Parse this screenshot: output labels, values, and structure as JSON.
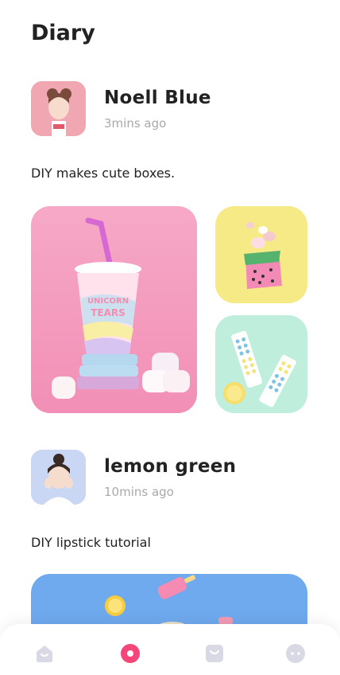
{
  "page": {
    "title": "Diary"
  },
  "posts": [
    {
      "author": "Noell Blue",
      "time": "3mins ago",
      "caption": "DIY makes cute boxes."
    },
    {
      "author": "lemon green",
      "time": "10mins ago",
      "caption": "DIY lipstick tutorial"
    }
  ],
  "photos": {
    "cup_text": [
      "UNICORN",
      "TEARS"
    ]
  },
  "nav": {
    "items": [
      {
        "icon": "home-icon"
      },
      {
        "icon": "record-icon",
        "active": true
      },
      {
        "icon": "bag-icon"
      },
      {
        "icon": "chat-icon"
      }
    ]
  },
  "colors": {
    "accent": "#f5467a",
    "nav_icon": "#d9d9e6",
    "muted_text": "#a9a9a9"
  }
}
